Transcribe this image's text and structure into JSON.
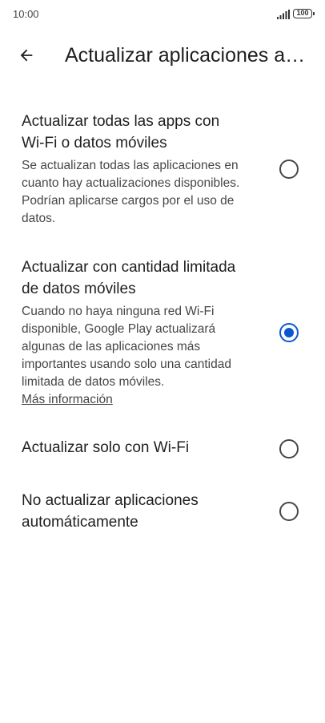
{
  "status_bar": {
    "time": "10:00",
    "battery": "100"
  },
  "header": {
    "title": "Actualizar aplicaciones automáticamente"
  },
  "options": [
    {
      "title": "Actualizar todas las apps con Wi-Fi o datos móviles",
      "description": "Se actualizan todas las aplicaciones en cuanto hay actualizaciones disponibles. Podrían aplicarse cargos por el uso de datos.",
      "selected": false
    },
    {
      "title": "Actualizar con cantidad limitada de datos móviles",
      "description": "Cuando no haya ninguna red Wi-Fi disponible, Google Play actualizará algunas de las aplicaciones más importantes usando solo una cantidad limitada de datos móviles.",
      "link": "Más información",
      "selected": true
    },
    {
      "title": "Actualizar solo con Wi-Fi",
      "selected": false
    },
    {
      "title": "No actualizar aplicaciones automáticamente",
      "selected": false
    }
  ],
  "colors": {
    "accent": "#0b57d0",
    "text_primary": "#1f1f1f",
    "text_secondary": "#444746"
  }
}
